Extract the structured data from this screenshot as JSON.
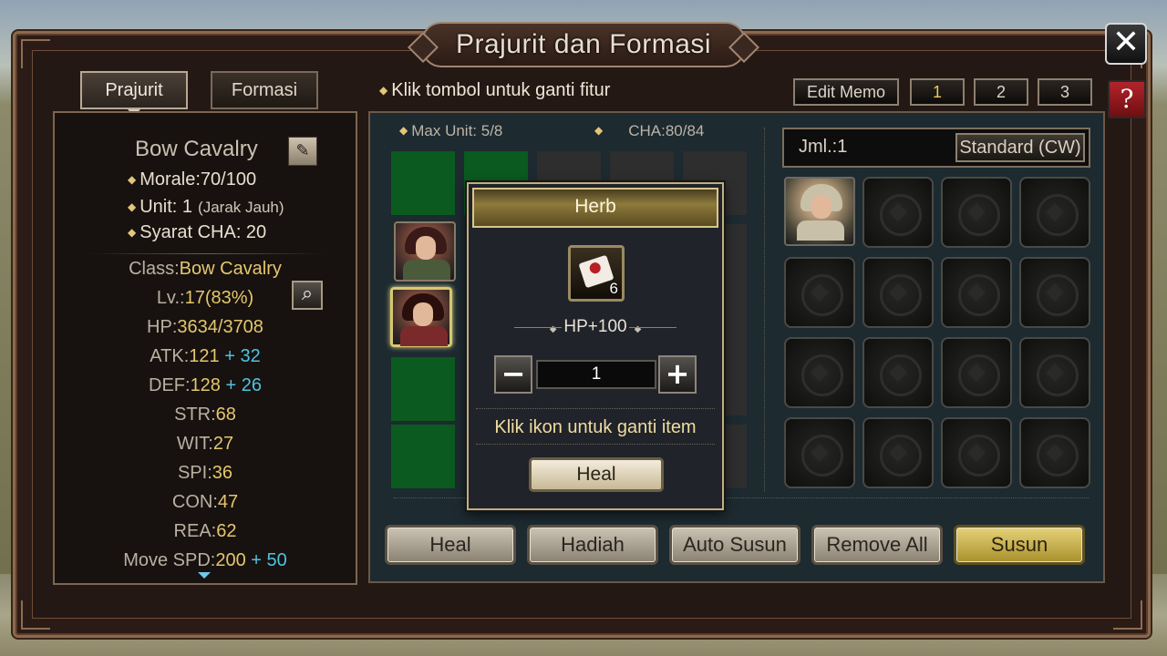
{
  "window": {
    "title": "Prajurit dan Formasi",
    "close_label": "✕",
    "help_label": "?"
  },
  "tabs": [
    {
      "label": "Prajurit",
      "active": true
    },
    {
      "label": "Formasi",
      "active": false
    }
  ],
  "hint": "Klik tombol untuk ganti fitur",
  "memo": {
    "edit_label": "Edit Memo",
    "slots": [
      "1",
      "2",
      "3"
    ],
    "selected": "1"
  },
  "unit": {
    "name": "Bow Cavalry",
    "morale": "Morale:70/100",
    "unit_line": "Unit: 1",
    "unit_range": "(Jarak Jauh)",
    "cha_req": "Syarat CHA: 20",
    "stats": {
      "class_label": "Class:",
      "class_value": "Bow Cavalry",
      "lv_label": "Lv.:",
      "lv_value": "17(83%)",
      "hp_label": "HP:",
      "hp_value": "3634/3708",
      "atk_label": "ATK:",
      "atk_value": "121",
      "atk_bonus": "+ 32",
      "def_label": "DEF:",
      "def_value": "128",
      "def_bonus": "+ 26",
      "str_label": "STR:",
      "str_value": "68",
      "wit_label": "WIT:",
      "wit_value": "27",
      "spi_label": "SPI:",
      "spi_value": "36",
      "con_label": "CON:",
      "con_value": "47",
      "rea_label": "REA:",
      "rea_value": "62",
      "spd_label": "Move SPD:",
      "spd_value": "200",
      "spd_bonus": "+ 50"
    }
  },
  "formation": {
    "max_unit": "Max Unit: 5/8",
    "cha": "CHA:80/84"
  },
  "roster": {
    "count_label": "Jml.:1",
    "filter_label": "Standard (CW)"
  },
  "popup": {
    "title": "Herb",
    "item_count": "6",
    "effect": "HP+100",
    "minus_label": "−",
    "plus_label": "+",
    "quantity": "1",
    "hint": "Klik ikon untuk ganti item",
    "action_label": "Heal"
  },
  "actions": {
    "heal": "Heal",
    "reward": "Hadiah",
    "auto": "Auto Susun",
    "remove_all": "Remove All",
    "arrange": "Susun"
  },
  "colors": {
    "stat_value": "#e5c66e",
    "stat_bonus": "#4fc3e2",
    "formation_cell": "#0b5a1f",
    "accent_gold": "#e6d278"
  }
}
